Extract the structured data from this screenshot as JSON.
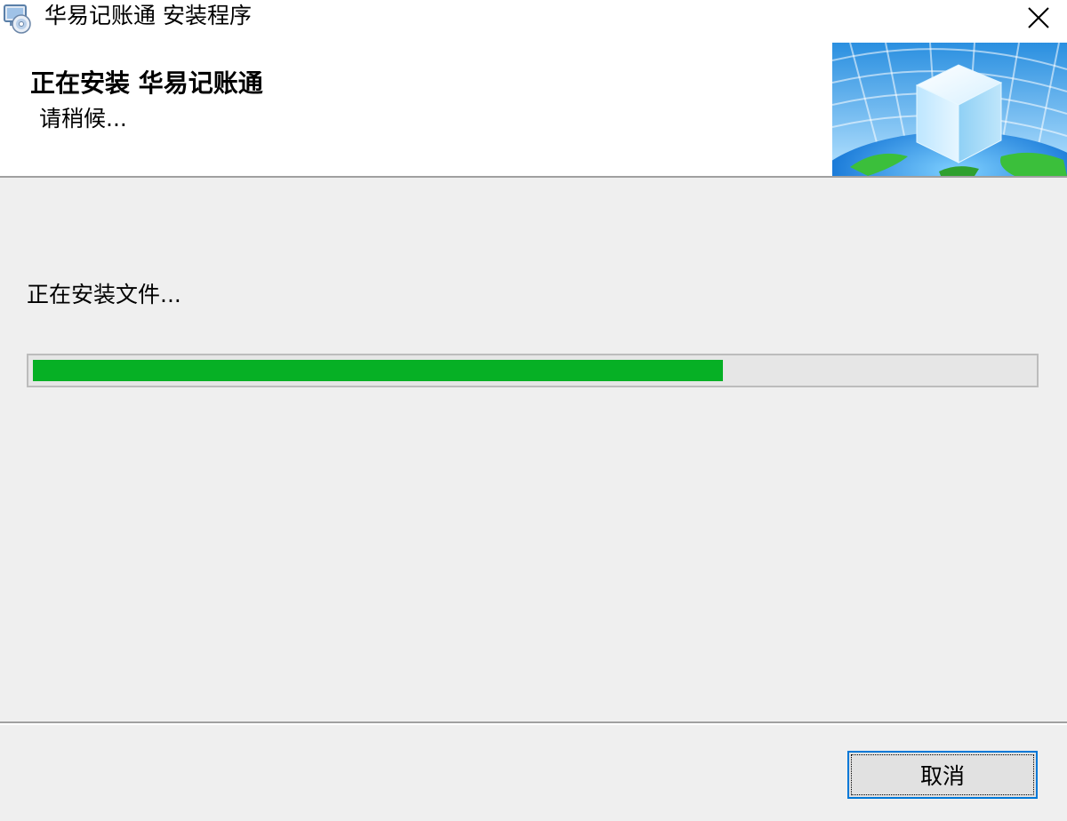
{
  "window": {
    "title": "华易记账通 安装程序",
    "app_icon": "installer-disc-icon",
    "close_icon": "close-icon"
  },
  "header": {
    "title": "正在安装  华易记账通",
    "subtitle": "请稍候...",
    "banner_image": "globe-cube-banner"
  },
  "main": {
    "status_text": "正在安装文件...",
    "progress": {
      "fraction": 0.69,
      "color": "#06b025"
    }
  },
  "footer": {
    "cancel_label": "取消"
  },
  "colors": {
    "accent": "#0078d7",
    "dialog_bg": "#efefef"
  }
}
